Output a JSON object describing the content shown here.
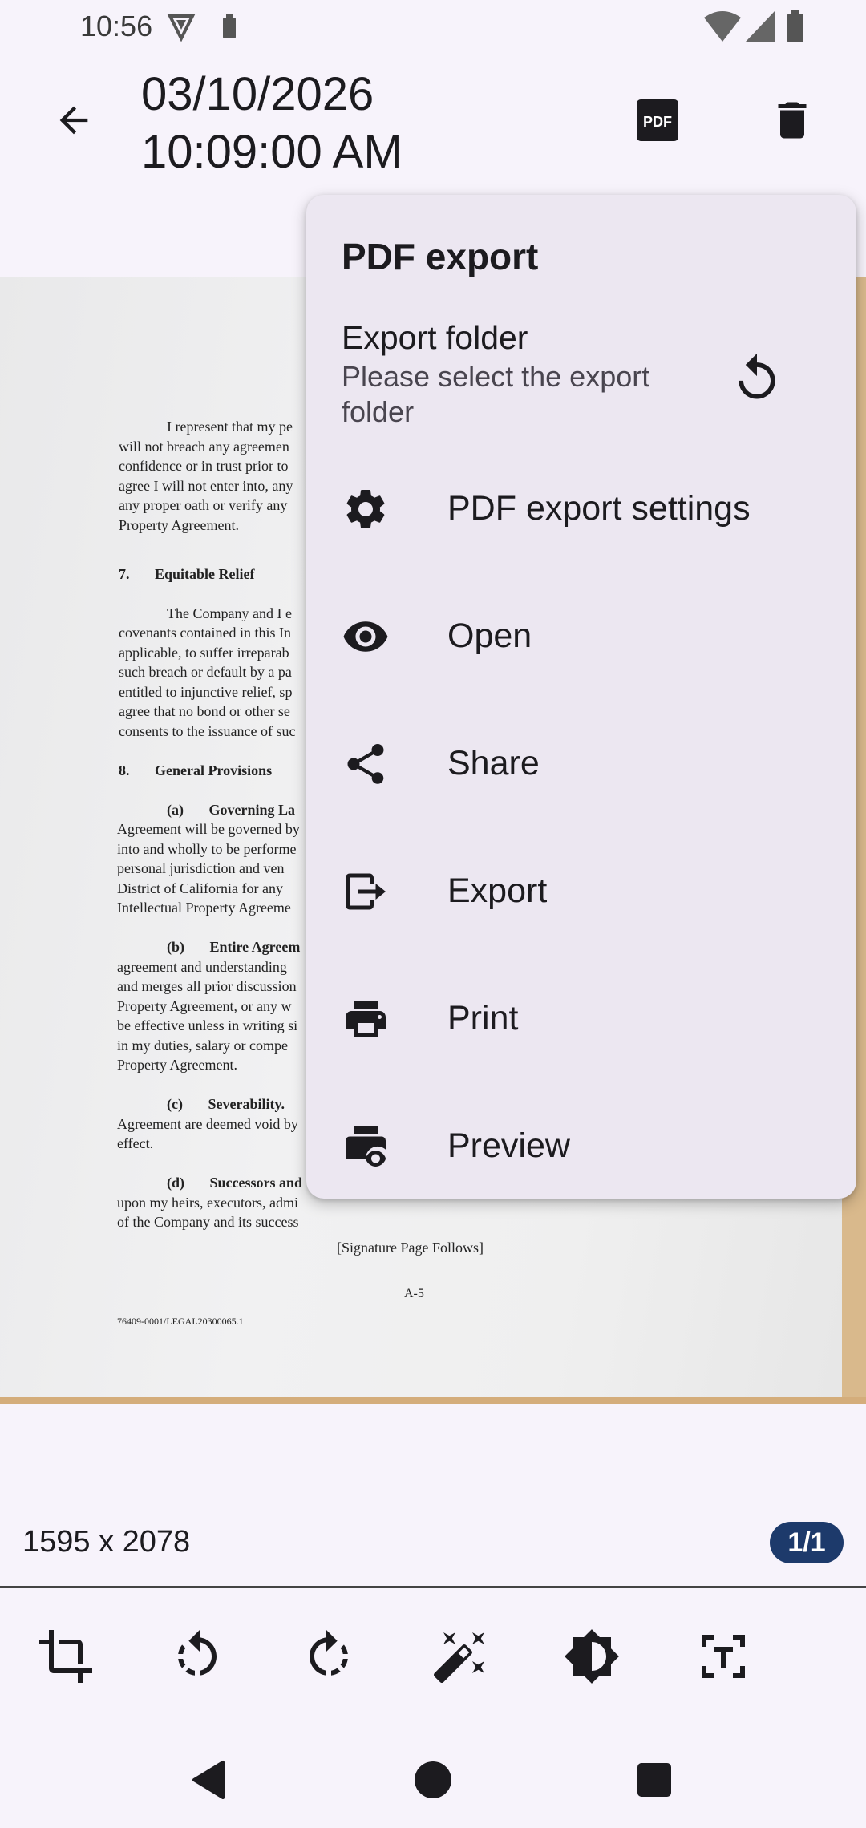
{
  "status_bar": {
    "time": "10:56"
  },
  "app_bar": {
    "title_line1": "03/10/2026",
    "title_line2": "10:09:00 AM"
  },
  "document": {
    "lines_left": [
      "I represent that my pe",
      "will not breach any agreemen",
      "confidence or in trust prior to",
      "agree I will not enter into, any",
      "any proper oath or verify any",
      "Property Agreement.",
      "7.       Equitable Relief",
      "The Company and I e",
      "covenants contained in this In",
      "applicable, to suffer irreparab",
      "such breach or default by a pa",
      "entitled to injunctive relief, sp",
      "agree that no bond or other se",
      "consents to the issuance of suc",
      "8.       General Provisions",
      "(a)       Governing La",
      "Agreement will be governed by",
      "into and wholly to be performe",
      "personal jurisdiction and ven",
      "District of California for any",
      "Intellectual Property Agreeme",
      "(b)       Entire Agreem",
      "agreement and understanding",
      "and merges all prior discussion",
      "Property Agreement, or any w",
      "be effective unless in writing si",
      "in my duties, salary or compe",
      "Property Agreement.",
      "(c)       Severability.",
      "Agreement are deemed void by",
      "effect.",
      "(d)       Successors and",
      "upon my heirs, executors, admi",
      "of the Company and its success"
    ],
    "signature_follows": "[Signature Page Follows]",
    "page_label": "A-5",
    "footer_code": "76409-0001/LEGAL20300065.1"
  },
  "menu": {
    "header": "PDF export",
    "export_folder": {
      "title": "Export folder",
      "subtitle": "Please select the export folder",
      "reset_icon": "reset-icon"
    },
    "items": [
      {
        "label": "PDF export settings",
        "icon": "gear-icon"
      },
      {
        "label": "Open",
        "icon": "eye-icon"
      },
      {
        "label": "Share",
        "icon": "share-icon"
      },
      {
        "label": "Export",
        "icon": "export-icon"
      },
      {
        "label": "Print",
        "icon": "printer-icon"
      },
      {
        "label": "Preview",
        "icon": "print-preview-icon"
      }
    ]
  },
  "image_info": {
    "size": "1595 x 2078",
    "page": "1/1"
  },
  "toolbar": {
    "tools": [
      "crop-icon",
      "rotate-left-icon",
      "rotate-right-icon",
      "magic-wand-icon",
      "contrast-icon",
      "ocr-text-icon"
    ]
  },
  "colors": {
    "accent": "#1d3a6b",
    "menu_bg": "#ece7f1",
    "page_bg": "#f7f3fb"
  }
}
